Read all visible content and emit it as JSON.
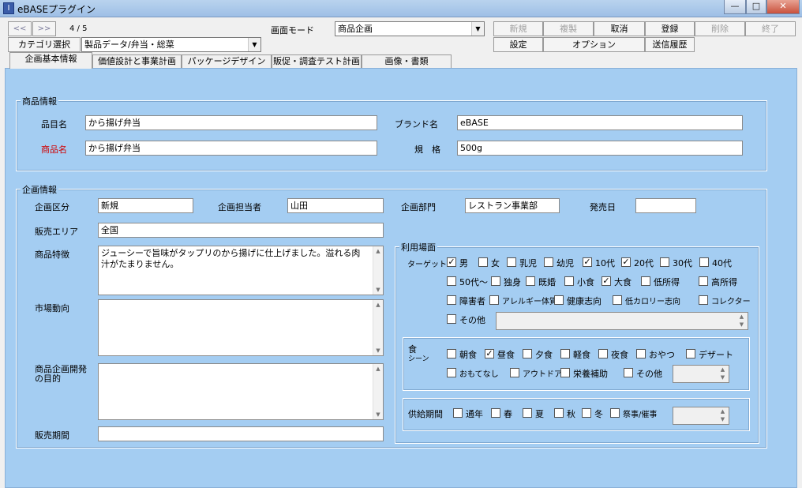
{
  "window": {
    "title": "eBASEプラグイン",
    "app_icon_glyph": "I",
    "minimize": "—",
    "maximize": "□",
    "close": "✕"
  },
  "toolbar": {
    "prev": "<<",
    "next": ">>",
    "record": "4 / 5",
    "screen_mode_label": "画面モード",
    "screen_mode_value": "商品企画",
    "category_button": "カテゴリ選択",
    "category_value": "製品データ/弁当・総菜",
    "new": "新規",
    "duplicate": "複製",
    "cancel": "取消",
    "register": "登録",
    "delete": "削除",
    "finish": "終了",
    "settings": "設定",
    "options": "オプション",
    "send_history": "送信履歴"
  },
  "tabs": [
    "企画基本情報",
    "価値設計と事業計画",
    "パッケージデザイン",
    "販促・調査テスト計画",
    "画像・書類"
  ],
  "product_info": {
    "legend": "商品情報",
    "item_name_label": "品目名",
    "item_name": "から揚げ弁当",
    "product_name_label": "商品名",
    "product_name": "から揚げ弁当",
    "brand_label": "ブランド名",
    "brand": "eBASE",
    "spec_label": "規　格",
    "spec": "500g"
  },
  "plan_info": {
    "legend": "企画情報",
    "category_label": "企画区分",
    "category": "新規",
    "manager_label": "企画担当者",
    "manager": "山田",
    "dept_label": "企画部門",
    "dept": "レストラン事業部",
    "release_label": "発売日",
    "release": "",
    "area_label": "販売エリア",
    "area": "全国",
    "features_label": "商品特徴",
    "features": "ジューシーで旨味がタップリのから揚げに仕上げました。溢れる肉汁がたまりません。",
    "market_label": "市場動向",
    "market": "",
    "purpose_label_1": "商品企画開発",
    "purpose_label_2": "の目的",
    "purpose": "",
    "period_label": "販売期間",
    "period": ""
  },
  "usage": {
    "legend": "利用場面",
    "target_label": "ターゲット",
    "targets": [
      {
        "label": "男",
        "checked": true
      },
      {
        "label": "女",
        "checked": false
      },
      {
        "label": "乳児",
        "checked": false
      },
      {
        "label": "幼児",
        "checked": false
      },
      {
        "label": "10代",
        "checked": true
      },
      {
        "label": "20代",
        "checked": true
      },
      {
        "label": "30代",
        "checked": false
      },
      {
        "label": "40代",
        "checked": false
      },
      {
        "label": "50代～",
        "checked": false
      },
      {
        "label": "独身",
        "checked": false
      },
      {
        "label": "既婚",
        "checked": false
      },
      {
        "label": "小食",
        "checked": false
      },
      {
        "label": "大食",
        "checked": true
      },
      {
        "label": "低所得",
        "checked": false
      },
      {
        "label": "高所得",
        "checked": false
      },
      {
        "label": "障害者",
        "checked": false
      },
      {
        "label": "アレルギー体質",
        "checked": false
      },
      {
        "label": "健康志向",
        "checked": false
      },
      {
        "label": "低カロリー志向",
        "checked": false
      },
      {
        "label": "コレクター",
        "checked": false
      },
      {
        "label": "その他",
        "checked": false
      }
    ],
    "food_label_1": "食",
    "food_label_2": "シーン",
    "scenes": [
      {
        "label": "朝食",
        "checked": false
      },
      {
        "label": "昼食",
        "checked": true
      },
      {
        "label": "夕食",
        "checked": false
      },
      {
        "label": "軽食",
        "checked": false
      },
      {
        "label": "夜食",
        "checked": false
      },
      {
        "label": "おやつ",
        "checked": false
      },
      {
        "label": "デザート",
        "checked": false
      },
      {
        "label": "おもてなし",
        "checked": false
      },
      {
        "label": "アウトドア",
        "checked": false
      },
      {
        "label": "栄養補助",
        "checked": false
      },
      {
        "label": "その他",
        "checked": false
      }
    ],
    "supply_label": "供給期間",
    "seasons": [
      {
        "label": "通年",
        "checked": false
      },
      {
        "label": "春",
        "checked": false
      },
      {
        "label": "夏",
        "checked": false
      },
      {
        "label": "秋",
        "checked": false
      },
      {
        "label": "冬",
        "checked": false
      },
      {
        "label": "祭事/催事",
        "checked": false
      }
    ]
  },
  "icons": {
    "check": "✓",
    "dropdown": "▼",
    "scroll_up": "▲",
    "scroll_down": "▼"
  }
}
